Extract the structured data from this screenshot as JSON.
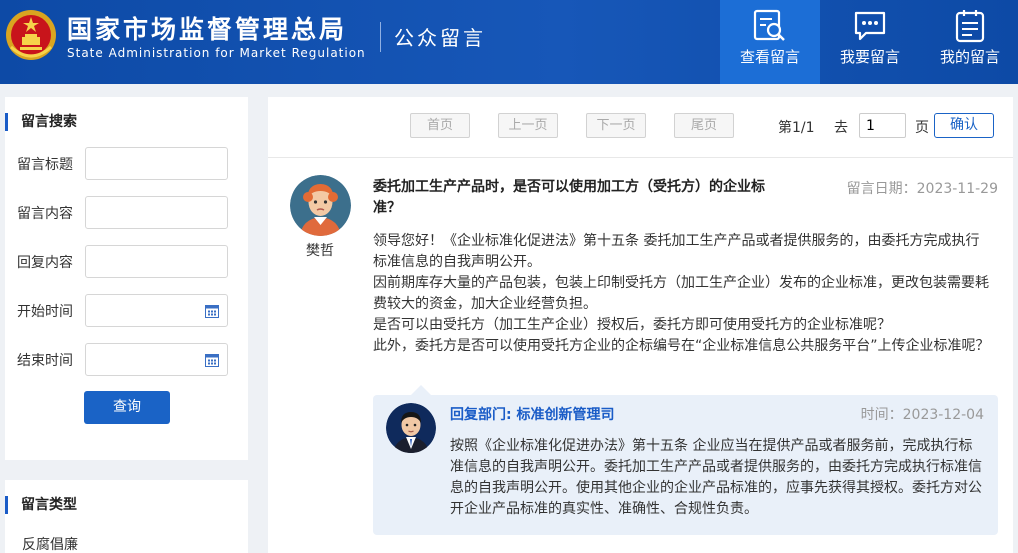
{
  "header": {
    "title": "国家市场监督管理总局",
    "subtitle": "State Administration for Market Regulation",
    "section": "公众留言",
    "nav": [
      {
        "label": "查看留言",
        "icon": "search-document-icon",
        "active": true
      },
      {
        "label": "我要留言",
        "icon": "chat-bubble-icon",
        "active": false
      },
      {
        "label": "我的留言",
        "icon": "clipboard-list-icon",
        "active": false
      }
    ]
  },
  "sidebar": {
    "search": {
      "title": "留言搜索",
      "fields": {
        "title_label": "留言标题",
        "content_label": "留言内容",
        "reply_label": "回复内容",
        "start_label": "开始时间",
        "end_label": "结束时间"
      },
      "query_button": "查询"
    },
    "types": {
      "title": "留言类型",
      "items": [
        "反腐倡廉"
      ]
    }
  },
  "pagination": {
    "first": "首页",
    "prev": "上一页",
    "next": "下一页",
    "last": "尾页",
    "page_info": "第1/1",
    "goto_label": "去",
    "goto_value": "1",
    "page_suffix": "页",
    "confirm": "确认"
  },
  "message": {
    "asker": "樊哲",
    "title": "委托加工生产产品时，是否可以使用加工方（受托方）的企业标准？",
    "date": "留言日期：2023-11-29",
    "body": [
      "领导您好！《企业标准化促进法》第十五条 委托加工生产产品或者提供服务的，由委托方完成执行标准信息的自我声明公开。",
      "因前期库存大量的产品包装，包装上印制受托方（加工生产企业）发布的企业标准，更改包装需要耗费较大的资金，加大企业经营负担。",
      "是否可以由受托方（加工生产企业）授权后，委托方即可使用受托方的企业标准呢？",
      "此外，委托方是否可以使用受托方企业的企标编号在“企业标准信息公共服务平台”上传企业标准呢？"
    ],
    "reply": {
      "dept": "回复部门: 标准创新管理司",
      "date": "时间：2023-12-04",
      "body": "按照《企业标准化促进办法》第十五条 企业应当在提供产品或者服务前，完成执行标准信息的自我声明公开。委托加工生产产品或者提供服务的，由委托方完成执行标准信息的自我声明公开。使用其他企业的企业产品标准的，应事先获得其授权。委托方对公开企业产品标准的真实性、准确性、合规性负责。"
    }
  },
  "colors": {
    "header_bg": "#1757b8",
    "nav_active": "#1c6ed6",
    "accent": "#1a63c6",
    "reply_bg": "#e9f0f9"
  }
}
